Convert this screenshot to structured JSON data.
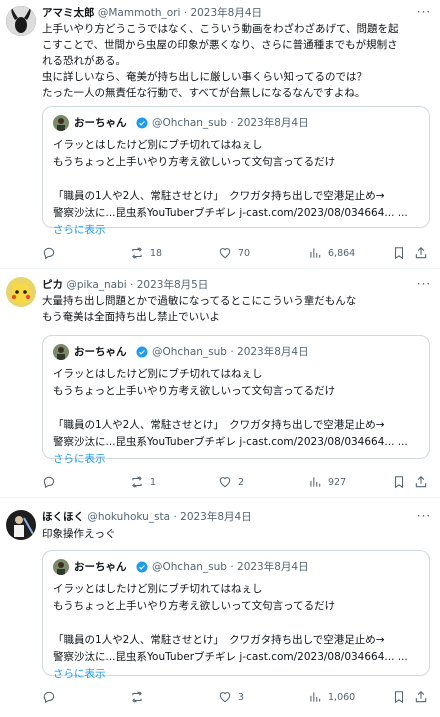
{
  "tweets": [
    {
      "name": "アマミ太郎",
      "handle": "@Mammoth_ori",
      "date": "2023年8月4日",
      "body": [
        "上手いやり方どうこうではなく、こういう動画をわざわざあげて、問題を起",
        "こすことで、世間から虫屋の印象が悪くなり、さらに普通種までもが規制さ",
        "れる恐れがある。",
        "虫に詳しいなら、奄美が持ち出しに厳しい事くらい知ってるのでは？",
        "たった一人の無責任な行動で、すべてが台無しになるなんですよね。"
      ],
      "replies": "",
      "retweets": "18",
      "likes": "70",
      "views": "6,864"
    },
    {
      "name": "ピカ",
      "handle": "@pika_nabi",
      "date": "2023年8月5日",
      "body": [
        "大量持ち出し問題とかで過敏になってるとこにこういう輩だもんな",
        "もう奄美は全面持ち出し禁止でいいよ"
      ],
      "replies": "",
      "retweets": "1",
      "likes": "2",
      "views": "927"
    },
    {
      "name": "ほくほく",
      "handle": "@hokuhoku_sta",
      "date": "2023年8月4日",
      "body": [
        "印象操作えっぐ"
      ],
      "replies": "",
      "retweets": "",
      "likes": "3",
      "views": "1,060"
    }
  ],
  "quote": {
    "name": "おーちゃん",
    "handle": "@Ohchan_sub",
    "date": "2023年8月4日",
    "lines": [
      "イラッとはしたけど別にブチ切れてはねぇし",
      "もうちょっと上手いやり方考え欲しいって文句言ってるだけ",
      "",
      "「職員の1人や2人、常駐させとけ」　クワガタ持ち出しで空港足止め→",
      "警察沙汰に...昆虫系YouTuberブチギレ j-cast.com/2023/08/034664... ..."
    ],
    "show_more": "さらに表示"
  },
  "colors": {
    "accent": "#1d9bf0",
    "verified": "#1d9bf0",
    "muted": "#536471",
    "border": "#cfd9de"
  },
  "icons": [
    "more-icon",
    "verified-icon",
    "reply-icon",
    "retweet-icon",
    "like-icon",
    "views-icon",
    "bookmark-icon",
    "share-icon"
  ]
}
